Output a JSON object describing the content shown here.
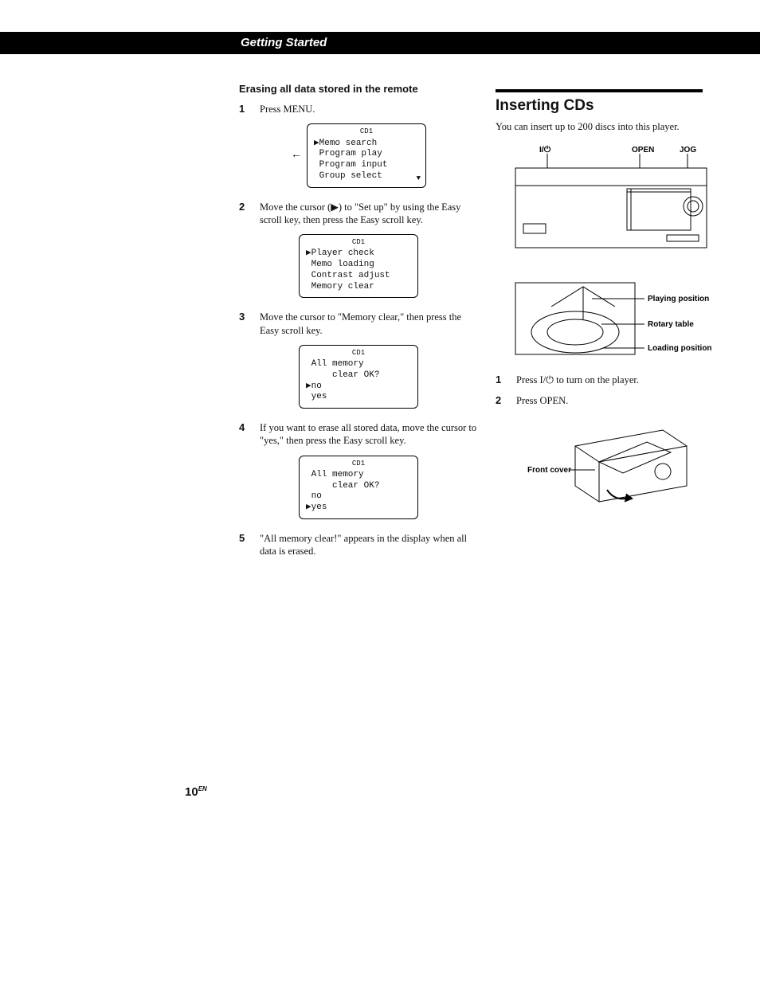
{
  "header": {
    "section": "Getting Started"
  },
  "left": {
    "title": "Erasing all data stored in the remote",
    "steps": {
      "1": "Press MENU.",
      "2": "Move the cursor (▶) to \"Set up\" by using the Easy scroll key, then press the Easy scroll key.",
      "3": "Move the cursor to \"Memory clear,\" then press the Easy scroll key.",
      "4": "If you want to erase all stored data, move the cursor to \"yes,\" then press the Easy scroll key.",
      "5": "\"All memory clear!\" appears in the display when all data is erased."
    },
    "lcd1": {
      "hdr": "CD1",
      "l1": "▶Memo search",
      "l2": " Program play",
      "l3": " Program input",
      "l4": " Group select"
    },
    "lcd2": {
      "hdr": "CD1",
      "l1": "▶Player check",
      "l2": " Memo loading",
      "l3": " Contrast adjust",
      "l4": " Memory clear"
    },
    "lcd3": {
      "hdr": "CD1",
      "l1": " All memory",
      "l2": "     clear OK?",
      "l3": "▶no",
      "l4": " yes"
    },
    "lcd4": {
      "hdr": "CD1",
      "l1": " All memory",
      "l2": "     clear OK?",
      "l3": " no",
      "l4": "▶yes"
    }
  },
  "right": {
    "title": "Inserting CDs",
    "intro": "You can insert up to 200 discs into this player.",
    "labels": {
      "power": "I/⏻",
      "open": "OPEN",
      "jog": "JOG",
      "playing": "Playing position",
      "rotary": "Rotary table",
      "loading": "Loading position",
      "front": "Front cover"
    },
    "steps": {
      "1": "Press I/⏻ to turn on the player.",
      "2": "Press OPEN."
    }
  },
  "page": {
    "num": "10",
    "suffix": "EN"
  }
}
